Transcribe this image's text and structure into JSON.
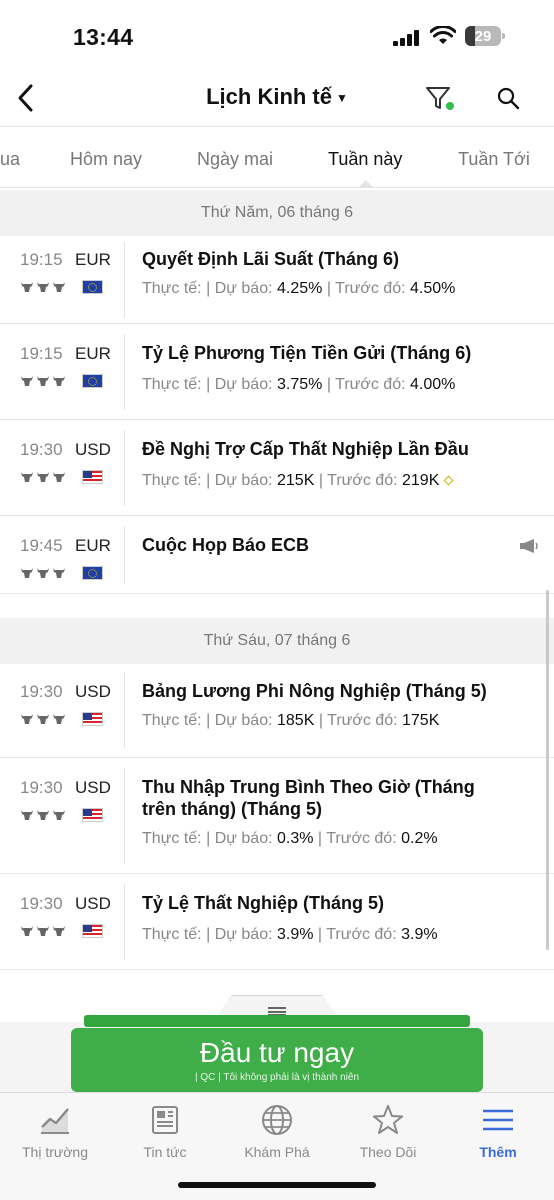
{
  "status": {
    "time": "13:44",
    "battery": "29",
    "battery_level": 0.29
  },
  "header": {
    "title": "Lịch Kinh tế",
    "back_icon": "chevron-left-icon",
    "filter_icon": "funnel-icon",
    "search_icon": "search-icon"
  },
  "tabs": [
    {
      "label": "ua"
    },
    {
      "label": "Hôm nay"
    },
    {
      "label": "Ngày mai"
    },
    {
      "label": "Tuần này",
      "active": true
    },
    {
      "label": "Tuần Tới"
    }
  ],
  "labels": {
    "actual": "Thực tế:",
    "forecast": "Dự báo:",
    "previous": "Trước đó:",
    "sep": "|"
  },
  "days": [
    {
      "date": "Thứ Năm, 06 tháng 6",
      "events": [
        {
          "time": "19:15",
          "currency": "EUR",
          "flag": "eu-flag",
          "title": "Quyết Định Lãi Suất (Tháng 6)",
          "forecast": "4.25%",
          "previous": "4.50%"
        },
        {
          "time": "19:15",
          "currency": "EUR",
          "flag": "eu-flag",
          "title": "Tỷ Lệ Phương Tiện Tiền Gửi (Tháng 6)",
          "forecast": "3.75%",
          "previous": "4.00%"
        },
        {
          "time": "19:30",
          "currency": "USD",
          "flag": "us-flag",
          "title": "Đề Nghị Trợ Cấp Thất Nghiệp Lần Đầu",
          "forecast": "215K",
          "previous": "219K"
        },
        {
          "time": "19:45",
          "currency": "EUR",
          "flag": "eu-flag",
          "title": "Cuộc Họp Báo ECB"
        }
      ]
    },
    {
      "date": "Thứ Sáu, 07 tháng 6",
      "events": [
        {
          "time": "19:30",
          "currency": "USD",
          "flag": "us-flag",
          "title": "Bảng Lương Phi Nông Nghiệp (Tháng 5)",
          "forecast": "185K",
          "previous": "175K"
        },
        {
          "time": "19:30",
          "currency": "USD",
          "flag": "us-flag",
          "title_line1": "Thu Nhập Trung Bình Theo Giờ (Tháng",
          "title_line2": "trên tháng) (Tháng 5)",
          "forecast": "0.3%",
          "previous": "0.2%"
        },
        {
          "time": "19:30",
          "currency": "USD",
          "flag": "us-flag",
          "title": "Tỷ Lệ Thất Nghiệp (Tháng 5)",
          "forecast": "3.9%",
          "previous": "3.9%"
        }
      ]
    }
  ],
  "ad": {
    "title": "Đầu tư ngay",
    "subtitle": "| QC | Tôi không phải là vị thành niên"
  },
  "nav": [
    {
      "label": "Thị trường",
      "icon": "chart-icon"
    },
    {
      "label": "Tin tức",
      "icon": "news-icon"
    },
    {
      "label": "Khám Phá",
      "icon": "globe-icon"
    },
    {
      "label": "Theo Dõi",
      "icon": "star-icon"
    },
    {
      "label": "Thêm",
      "icon": "menu-icon",
      "active": true
    }
  ],
  "colors": {
    "accent": "#3b6bd6",
    "ad_green": "#3fae48",
    "filter_dot": "#2fbf4a"
  }
}
